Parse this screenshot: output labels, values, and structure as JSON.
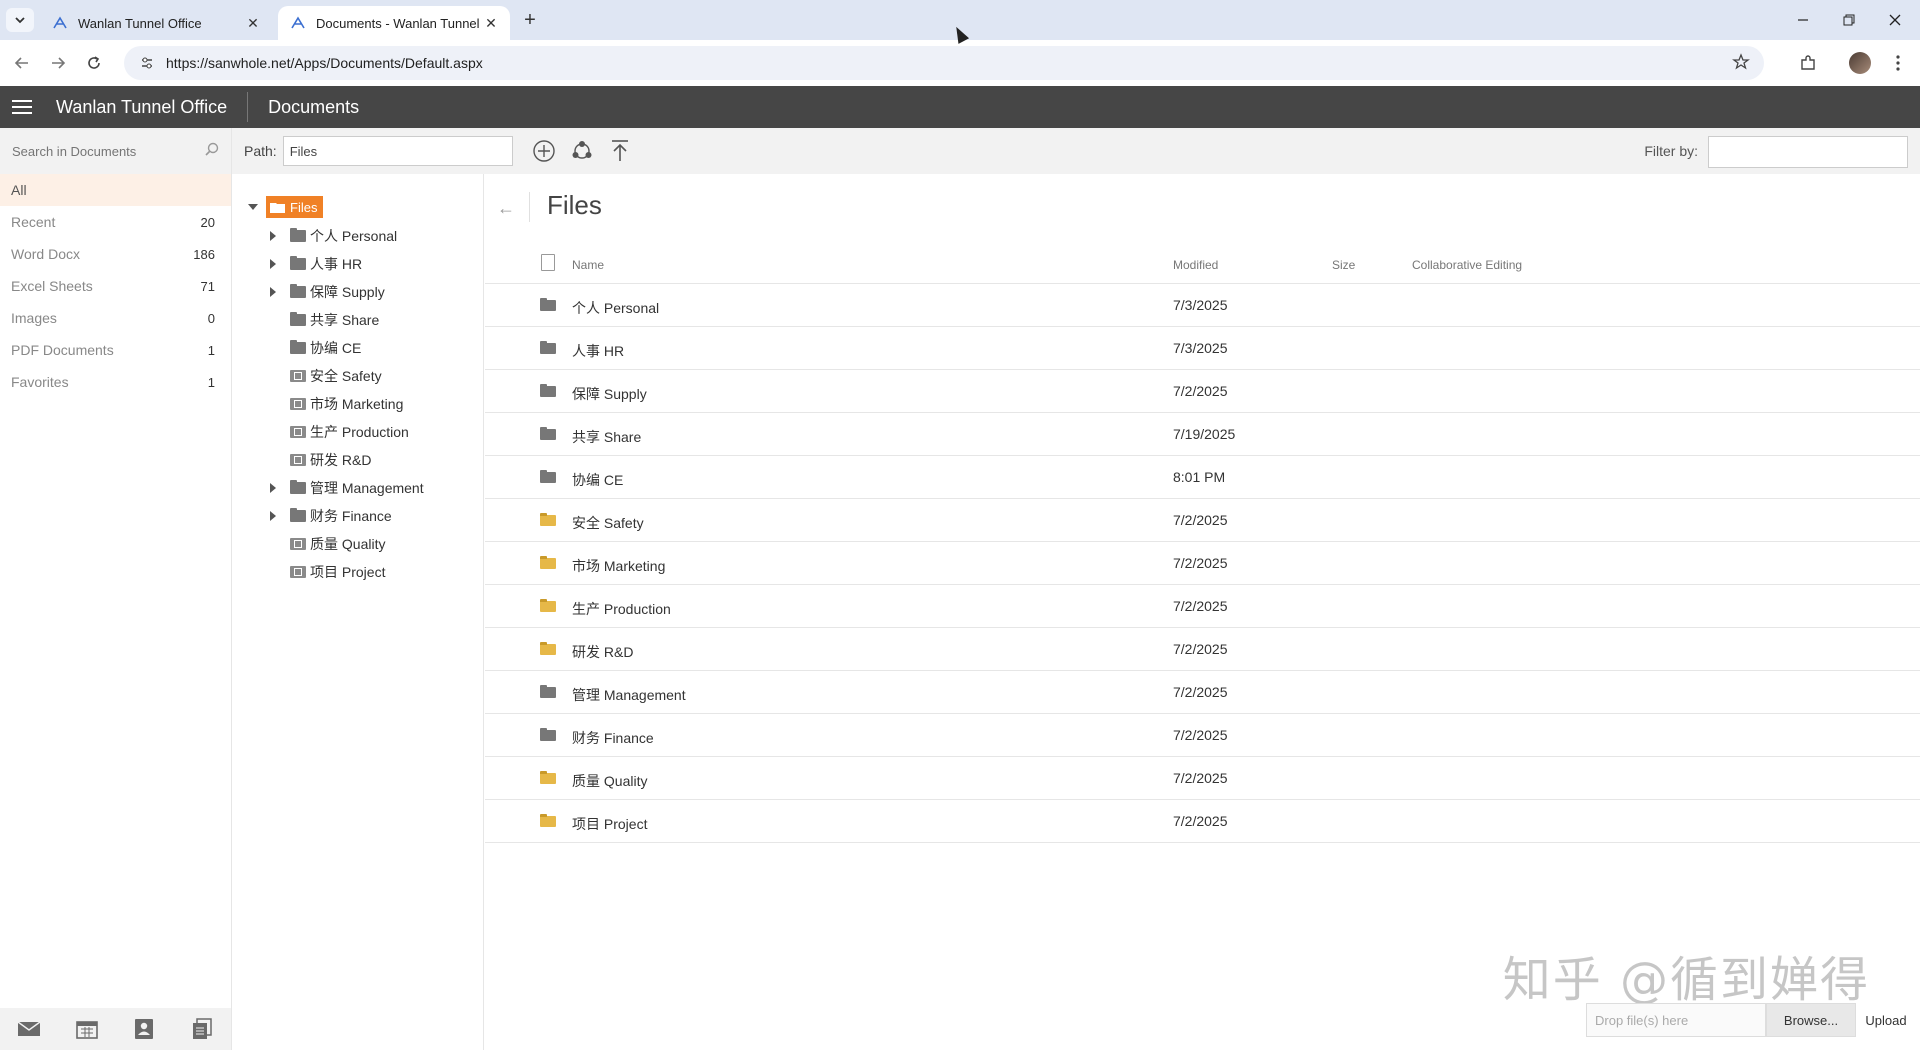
{
  "browser": {
    "tabs": [
      {
        "title": "Wanlan Tunnel Office"
      },
      {
        "title": "Documents - Wanlan Tunnel O"
      }
    ],
    "url": "https://sanwhole.net/Apps/Documents/Default.aspx"
  },
  "app": {
    "title": "Wanlan Tunnel Office",
    "section": "Documents"
  },
  "sidebar": {
    "search_placeholder": "Search in Documents",
    "categories": [
      {
        "label": "All",
        "count": ""
      },
      {
        "label": "Recent",
        "count": "20"
      },
      {
        "label": "Word Docx",
        "count": "186"
      },
      {
        "label": "Excel Sheets",
        "count": "71"
      },
      {
        "label": "Images",
        "count": "0"
      },
      {
        "label": "PDF Documents",
        "count": "1"
      },
      {
        "label": "Favorites",
        "count": "1"
      }
    ]
  },
  "pathbar": {
    "path_label": "Path:",
    "path_value": "Files",
    "filter_label": "Filter by:"
  },
  "tree": {
    "root": "Files",
    "items": [
      {
        "label": "个人 Personal",
        "expandable": true,
        "icon": "folder"
      },
      {
        "label": "人事 HR",
        "expandable": true,
        "icon": "folder"
      },
      {
        "label": "保障 Supply",
        "expandable": true,
        "icon": "folder"
      },
      {
        "label": "共享 Share",
        "expandable": false,
        "icon": "folder"
      },
      {
        "label": "协编 CE",
        "expandable": false,
        "icon": "folder"
      },
      {
        "label": "安全 Safety",
        "expandable": false,
        "icon": "locked-folder"
      },
      {
        "label": "市场 Marketing",
        "expandable": false,
        "icon": "locked-folder"
      },
      {
        "label": "生产 Production",
        "expandable": false,
        "icon": "locked-folder"
      },
      {
        "label": "研发 R&D",
        "expandable": false,
        "icon": "locked-folder"
      },
      {
        "label": "管理 Management",
        "expandable": true,
        "icon": "folder"
      },
      {
        "label": "财务 Finance",
        "expandable": true,
        "icon": "folder"
      },
      {
        "label": "质量 Quality",
        "expandable": false,
        "icon": "locked-folder"
      },
      {
        "label": "项目 Project",
        "expandable": false,
        "icon": "locked-folder"
      }
    ]
  },
  "filelist": {
    "title": "Files",
    "columns": {
      "name": "Name",
      "modified": "Modified",
      "size": "Size",
      "collab": "Collaborative Editing"
    },
    "rows": [
      {
        "name": "个人 Personal",
        "modified": "7/3/2025",
        "icon": "folder-gray"
      },
      {
        "name": "人事 HR",
        "modified": "7/3/2025",
        "icon": "folder-gray"
      },
      {
        "name": "保障 Supply",
        "modified": "7/2/2025",
        "icon": "folder-gray"
      },
      {
        "name": "共享 Share",
        "modified": "7/19/2025",
        "icon": "folder-gray"
      },
      {
        "name": "协编 CE",
        "modified": "8:01 PM",
        "icon": "folder-gray"
      },
      {
        "name": "安全 Safety",
        "modified": "7/2/2025",
        "icon": "folder-yellow"
      },
      {
        "name": "市场 Marketing",
        "modified": "7/2/2025",
        "icon": "folder-yellow"
      },
      {
        "name": "生产 Production",
        "modified": "7/2/2025",
        "icon": "folder-yellow"
      },
      {
        "name": "研发 R&D",
        "modified": "7/2/2025",
        "icon": "folder-yellow"
      },
      {
        "name": "管理 Management",
        "modified": "7/2/2025",
        "icon": "folder-gray"
      },
      {
        "name": "财务 Finance",
        "modified": "7/2/2025",
        "icon": "folder-gray"
      },
      {
        "name": "质量 Quality",
        "modified": "7/2/2025",
        "icon": "folder-yellow"
      },
      {
        "name": "项目 Project",
        "modified": "7/2/2025",
        "icon": "folder-yellow"
      }
    ]
  },
  "upload": {
    "drop_placeholder": "Drop file(s) here",
    "browse": "Browse...",
    "upload": "Upload"
  },
  "watermark": "知乎 @循到婵得",
  "colors": {
    "appbar": "#464646",
    "accent": "#f08126",
    "active_category": "#fdf0e6"
  }
}
